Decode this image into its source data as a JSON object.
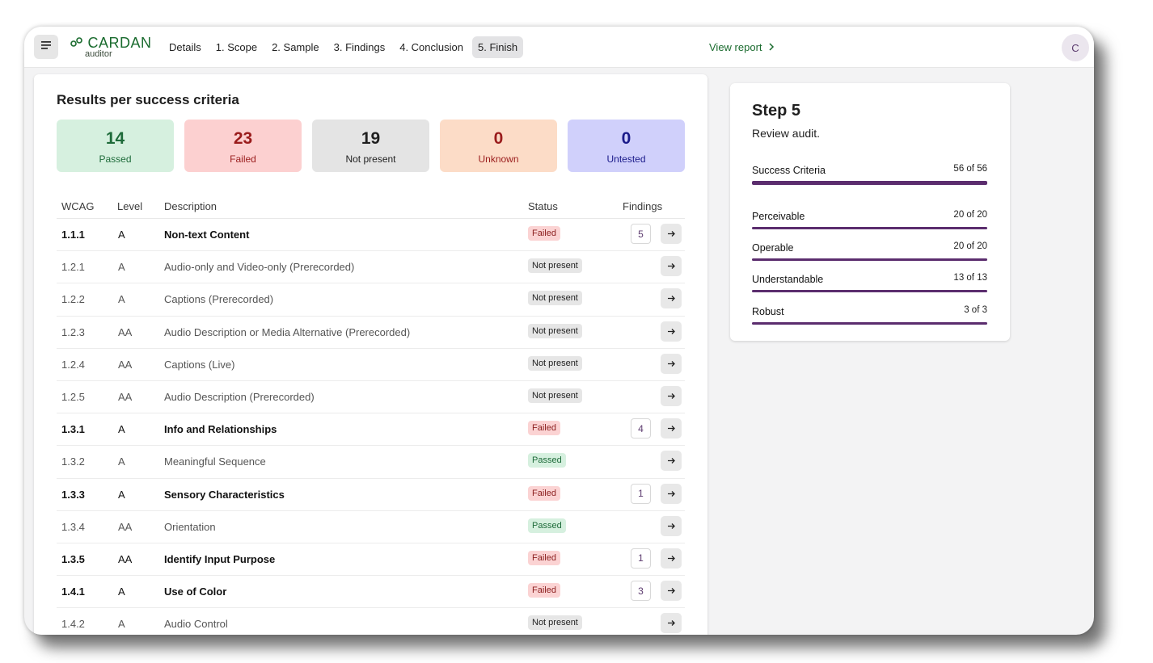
{
  "header": {
    "logo_main": "CARDAN",
    "logo_sub": "auditor",
    "nav": [
      "Details",
      "1. Scope",
      "2. Sample",
      "3. Findings",
      "4. Conclusion",
      "5. Finish"
    ],
    "active_nav": "5. Finish",
    "view_report": "View report",
    "avatar_letter": "C"
  },
  "results": {
    "title": "Results per success criteria",
    "stats": [
      {
        "value": "14",
        "label": "Passed",
        "bg": "#d6f0df",
        "fg": "#1e6b3a"
      },
      {
        "value": "23",
        "label": "Failed",
        "bg": "#fcd0d0",
        "fg": "#9a1c1c"
      },
      {
        "value": "19",
        "label": "Not present",
        "bg": "#e4e4e4",
        "fg": "#1f1f1f"
      },
      {
        "value": "0",
        "label": "Unknown",
        "bg": "#fcdcc7",
        "fg": "#9a1c1c"
      },
      {
        "value": "0",
        "label": "Untested",
        "bg": "#d0d0fb",
        "fg": "#1a1a8a"
      }
    ],
    "columns": [
      "WCAG",
      "Level",
      "Description",
      "Status",
      "Findings"
    ],
    "rows": [
      {
        "wcag": "1.1.1",
        "level": "A",
        "description": "Non-text Content",
        "status": "Failed",
        "findings": "5"
      },
      {
        "wcag": "1.2.1",
        "level": "A",
        "description": "Audio-only and Video-only (Prerecorded)",
        "status": "Not present",
        "findings": ""
      },
      {
        "wcag": "1.2.2",
        "level": "A",
        "description": "Captions (Prerecorded)",
        "status": "Not present",
        "findings": ""
      },
      {
        "wcag": "1.2.3",
        "level": "AA",
        "description": "Audio Description or Media Alternative (Prerecorded)",
        "status": "Not present",
        "findings": ""
      },
      {
        "wcag": "1.2.4",
        "level": "AA",
        "description": "Captions (Live)",
        "status": "Not present",
        "findings": ""
      },
      {
        "wcag": "1.2.5",
        "level": "AA",
        "description": "Audio Description (Prerecorded)",
        "status": "Not present",
        "findings": ""
      },
      {
        "wcag": "1.3.1",
        "level": "A",
        "description": "Info and Relationships",
        "status": "Failed",
        "findings": "4"
      },
      {
        "wcag": "1.3.2",
        "level": "A",
        "description": "Meaningful Sequence",
        "status": "Passed",
        "findings": ""
      },
      {
        "wcag": "1.3.3",
        "level": "A",
        "description": "Sensory Characteristics",
        "status": "Failed",
        "findings": "1"
      },
      {
        "wcag": "1.3.4",
        "level": "AA",
        "description": "Orientation",
        "status": "Passed",
        "findings": ""
      },
      {
        "wcag": "1.3.5",
        "level": "AA",
        "description": "Identify Input Purpose",
        "status": "Failed",
        "findings": "1"
      },
      {
        "wcag": "1.4.1",
        "level": "A",
        "description": "Use of Color",
        "status": "Failed",
        "findings": "3"
      },
      {
        "wcag": "1.4.2",
        "level": "A",
        "description": "Audio Control",
        "status": "Not present",
        "findings": ""
      }
    ]
  },
  "step": {
    "title": "Step 5",
    "subtitle": "Review audit.",
    "progress": [
      {
        "label": "Success Criteria",
        "value": "56 of 56",
        "fraction": 1.0,
        "big": true
      },
      {
        "label": "Perceivable",
        "value": "20 of 20",
        "fraction": 1.0,
        "big": false
      },
      {
        "label": "Operable",
        "value": "20 of 20",
        "fraction": 1.0,
        "big": false
      },
      {
        "label": "Understandable",
        "value": "13 of 13",
        "fraction": 1.0,
        "big": false
      },
      {
        "label": "Robust",
        "value": "3 of 3",
        "fraction": 1.0,
        "big": false
      }
    ]
  },
  "icons": {
    "menu": "menu-icon",
    "logo": "link-icon",
    "chevron": "chevron-right-icon",
    "arrow": "arrow-right-icon"
  }
}
